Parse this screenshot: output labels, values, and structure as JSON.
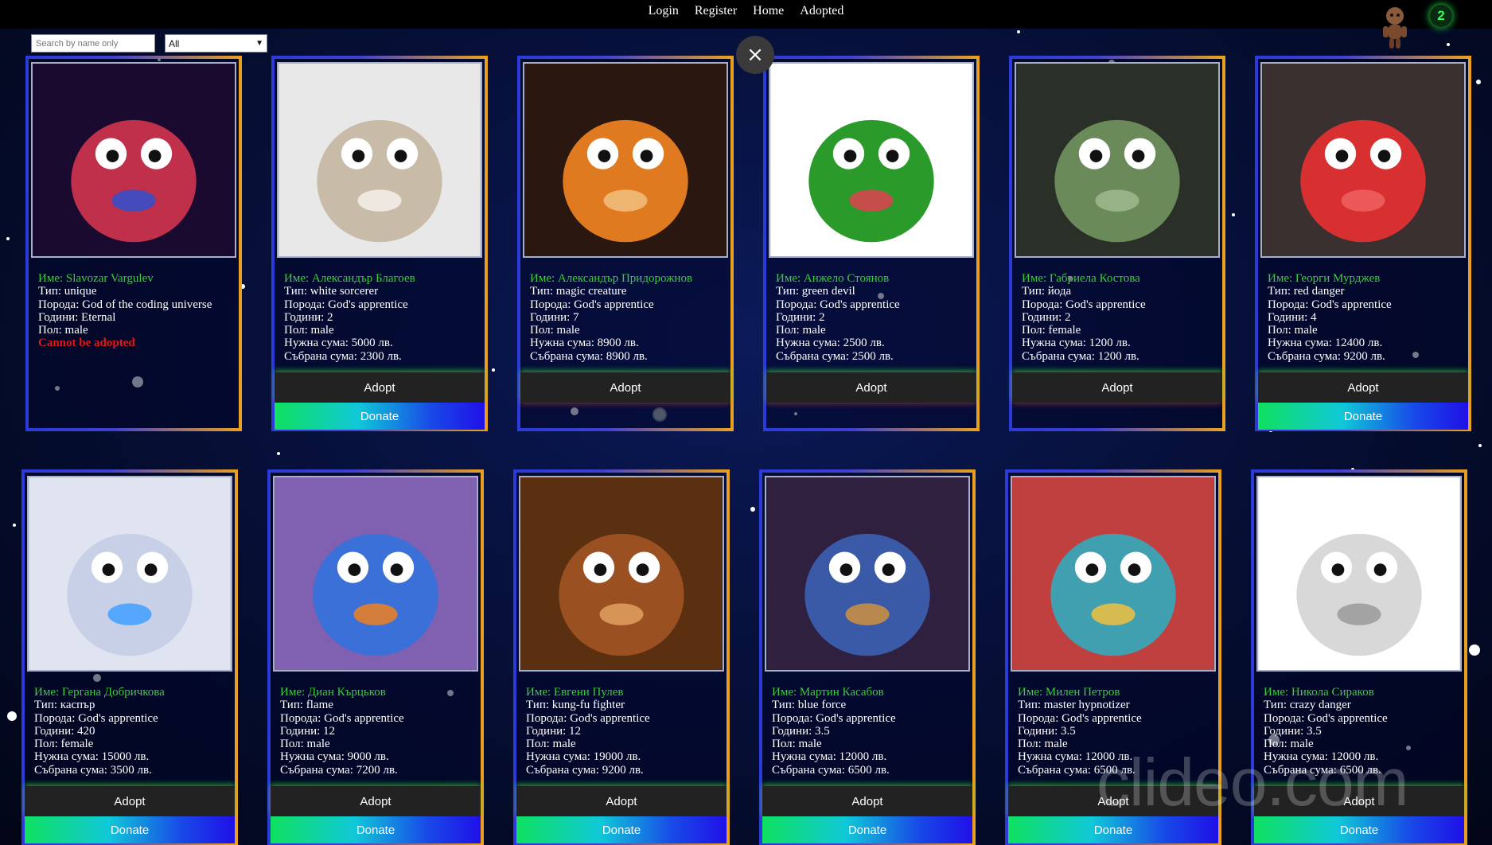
{
  "nav": {
    "login": "Login",
    "register": "Register",
    "home": "Home",
    "adopted": "Adopted"
  },
  "counter": "2",
  "search": {
    "placeholder": "Search by name only"
  },
  "filter": {
    "selected": "All"
  },
  "close_symbol": "×",
  "watermark": "clideo.com",
  "buttons": {
    "adopt": "Adopt",
    "donate": "Donate"
  },
  "colors": {
    "name": "#3ccc3c",
    "warn": "#e01818",
    "border_left": "#2a3bd8",
    "border_right": "#e8a020",
    "counter": "#2aff5a"
  },
  "cards": [
    {
      "name": "Име: Slavozar Vargulev",
      "type": "Тип: unique",
      "breed": "Порода: God of the coding universe",
      "age": "Години: Eternal",
      "sex": "Пол: male",
      "warning": "Cannot be adopted",
      "adoptable": false
    },
    {
      "name": "Име: Александър Благоев",
      "type": "Тип: white sorcerer",
      "breed": "Порода: God's apprentice",
      "age": "Години: 2",
      "sex": "Пол: male",
      "needed": "Нужна сума: 5000 лв.",
      "collected": "Събрана сума: 2300 лв.",
      "adoptable": true,
      "donate": true
    },
    {
      "name": "Име: Александър Придорожнов",
      "type": "Тип: magic creature",
      "breed": "Порода: God's apprentice",
      "age": "Години: 7",
      "sex": "Пол: male",
      "needed": "Нужна сума: 8900 лв.",
      "collected": "Събрана сума: 8900 лв.",
      "adoptable": true,
      "donate": false
    },
    {
      "name": "Име: Анжело Стоянов",
      "type": "Тип: green devil",
      "breed": "Порода: God's apprentice",
      "age": "Години: 2",
      "sex": "Пол: male",
      "needed": "Нужна сума: 2500 лв.",
      "collected": "Събрана сума: 2500 лв.",
      "adoptable": true,
      "donate": false
    },
    {
      "name": "Име: Габриела Костова",
      "type": "Тип: йода",
      "breed": "Порода: God's apprentice",
      "age": "Години: 2",
      "sex": "Пол: female",
      "needed": "Нужна сума: 1200 лв.",
      "collected": "Събрана сума: 1200 лв.",
      "adoptable": true,
      "donate": false
    },
    {
      "name": "Име: Георги Мурджев",
      "type": "Тип: red danger",
      "breed": "Порода: God's apprentice",
      "age": "Години: 4",
      "sex": "Пол: male",
      "needed": "Нужна сума: 12400 лв.",
      "collected": "Събрана сума: 9200 лв.",
      "adoptable": true,
      "donate": true
    },
    {
      "name": "Име: Гергана Добричкова",
      "type": "Тип: каспър",
      "breed": "Порода: God's apprentice",
      "age": "Години: 420",
      "sex": "Пол: female",
      "needed": "Нужна сума: 15000 лв.",
      "collected": "Събрана сума: 3500 лв.",
      "adoptable": true,
      "donate": true
    },
    {
      "name": "Име: Диан Кърцьков",
      "type": "Тип: flame",
      "breed": "Порода: God's apprentice",
      "age": "Години: 12",
      "sex": "Пол: male",
      "needed": "Нужна сума: 9000 лв.",
      "collected": "Събрана сума: 7200 лв.",
      "adoptable": true,
      "donate": true
    },
    {
      "name": "Име: Евгени Пулев",
      "type": "Тип: kung-fu fighter",
      "breed": "Порода: God's apprentice",
      "age": "Години: 12",
      "sex": "Пол: male",
      "needed": "Нужна сума: 19000 лв.",
      "collected": "Събрана сума: 9200 лв.",
      "adoptable": true,
      "donate": true
    },
    {
      "name": "Име: Мартин Касабов",
      "type": "Тип: blue force",
      "breed": "Порода: God's apprentice",
      "age": "Години: 3.5",
      "sex": "Пол: male",
      "needed": "Нужна сума: 12000 лв.",
      "collected": "Събрана сума: 6500 лв.",
      "adoptable": true,
      "donate": true
    },
    {
      "name": "Име: Милен Петров",
      "type": "Тип: master hypnotizer",
      "breed": "Порода: God's apprentice",
      "age": "Години: 3.5",
      "sex": "Пол: male",
      "needed": "Нужна сума: 12000 лв.",
      "collected": "Събрана сума: 6500 лв.",
      "adoptable": true,
      "donate": true
    },
    {
      "name": "Име: Никола Сираков",
      "type": "Тип: crazy danger",
      "breed": "Порода: God's apprentice",
      "age": "Години: 3.5",
      "sex": "Пол: male",
      "needed": "Нужна сума: 12000 лв.",
      "collected": "Събрана сума: 6500 лв.",
      "adoptable": true,
      "donate": true
    }
  ]
}
